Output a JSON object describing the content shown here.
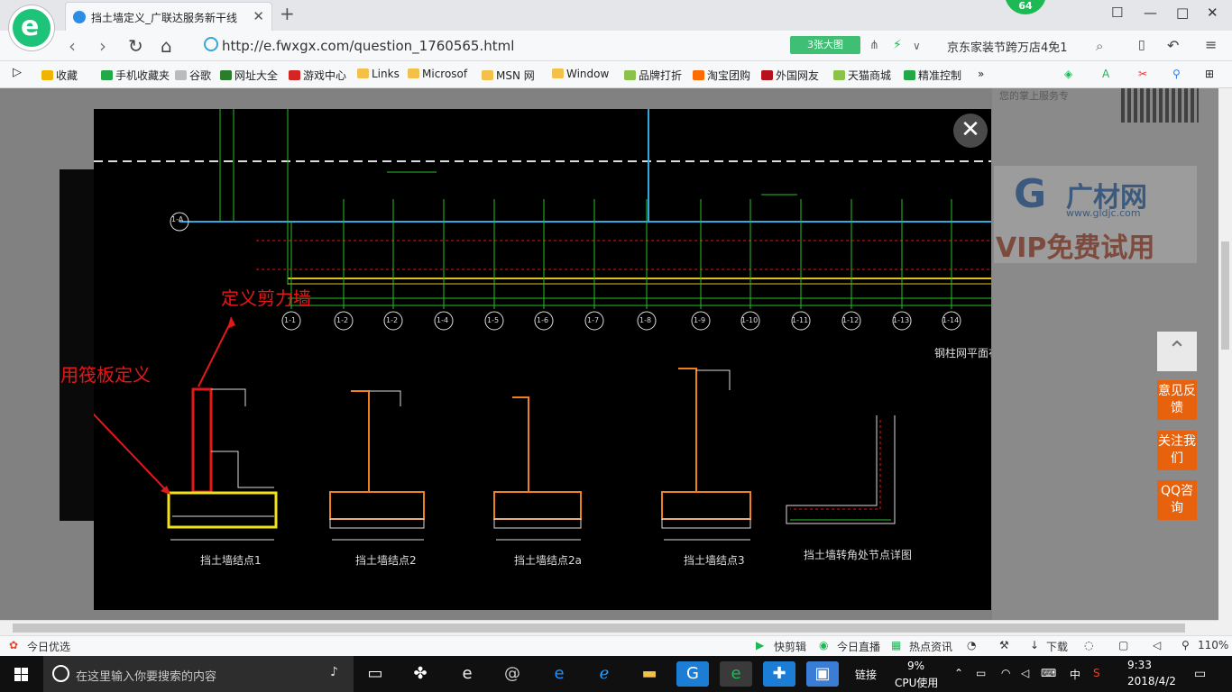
{
  "browser": {
    "tab_title": "挡土墙定义_广联达服务新干线",
    "close_glyph": "✕",
    "new_tab_glyph": "+",
    "badge_count": "64",
    "window_controls": [
      "☐",
      "—",
      "□",
      "✕"
    ]
  },
  "navbar": {
    "url": "http://e.fwxgx.com/question_1760565.html",
    "big_image_button": "3张大图",
    "promo_text": "京东家装节跨万店4免1"
  },
  "bookmarks": [
    {
      "label": "收藏",
      "color": "#f0b400"
    },
    {
      "label": "手机收藏夹",
      "color": "#22a845"
    },
    {
      "label": "谷歌",
      "color": "#bbbbbb"
    },
    {
      "label": "网址大全",
      "color": "#2a7d2a"
    },
    {
      "label": "游戏中心",
      "color": "#d42424"
    },
    {
      "label": "Links",
      "color": "#f3c04a"
    },
    {
      "label": "Microsof",
      "color": "#f3c04a"
    },
    {
      "label": "MSN 网",
      "color": "#f3c04a"
    },
    {
      "label": "Window",
      "color": "#f3c04a"
    },
    {
      "label": "品牌打折",
      "color": "#8bc34a"
    },
    {
      "label": "淘宝团购",
      "color": "#ff6a00"
    },
    {
      "label": "外国网友",
      "color": "#b5121b"
    },
    {
      "label": "天猫商城",
      "color": "#8bc34a"
    },
    {
      "label": "精准控制",
      "color": "#22a845"
    }
  ],
  "sidebar": {
    "phone_text": "您的掌上服务专",
    "brand_name": "广材网",
    "brand_domain": "www.gldjc.com",
    "vip_text": "VIP免费试用",
    "buttons": [
      "意见反馈",
      "关注我们",
      "QQ咨询"
    ]
  },
  "viewer": {
    "close_glyph": "✕",
    "annotations": {
      "shear_wall": "定义剪力墙",
      "raft": "用筏板定义"
    },
    "column_plan_title": "钢柱网平面布",
    "axis_labels": [
      "1-1",
      "1-2",
      "1-2",
      "1-4",
      "1-5",
      "1-6",
      "1-7",
      "1-8",
      "1-9",
      "1-10",
      "1-11",
      "1-12",
      "1-13",
      "1-14"
    ],
    "left_axis": "1-A",
    "section_titles": [
      "挡土墙结点1",
      "挡土墙结点2",
      "挡土墙结点2a",
      "挡土墙结点3",
      "挡土墙转角处节点详图"
    ]
  },
  "statusbar": {
    "left": "今日优选",
    "items": [
      "快剪辑",
      "今日直播",
      "热点资讯",
      "下载"
    ],
    "zoom": "110%"
  },
  "taskbar": {
    "search_placeholder": "在这里输入你要搜索的内容",
    "link_label": "链接",
    "cpu_percent": "9%",
    "cpu_label": "CPU使用",
    "ime": "中",
    "time": "9:33",
    "date": "2018/4/2"
  }
}
